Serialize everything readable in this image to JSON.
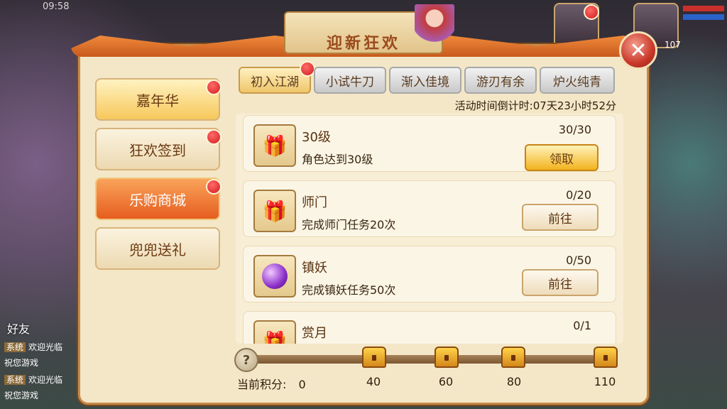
{
  "status": {
    "time": "09:58"
  },
  "window": {
    "title": "迎新狂欢",
    "close_label": "✕"
  },
  "sidebar": {
    "items": [
      {
        "label": "嘉年华",
        "has_dot": true
      },
      {
        "label": "狂欢签到",
        "has_dot": true
      },
      {
        "label": "乐购商城",
        "has_dot": true,
        "active": true
      },
      {
        "label": "兜兜送礼",
        "has_dot": false
      }
    ]
  },
  "tabs": [
    {
      "label": "初入江湖",
      "active": true,
      "has_dot": true
    },
    {
      "label": "小试牛刀"
    },
    {
      "label": "渐入佳境"
    },
    {
      "label": "游刃有余"
    },
    {
      "label": "炉火纯青"
    }
  ],
  "countdown": "活动时间倒计时:07天23小时52分",
  "tasks": [
    {
      "name": "30级",
      "desc": "角色达到30级",
      "progress": "30/30",
      "button": "领取",
      "icon": "gift-bag-icon"
    },
    {
      "name": "师门",
      "desc": "完成师门任务20次",
      "progress": "0/20",
      "button": "前往",
      "icon": "gift-bag-icon"
    },
    {
      "name": "镇妖",
      "desc": "完成镇妖任务50次",
      "progress": "0/50",
      "button": "前往",
      "icon": "exp-orb-icon"
    },
    {
      "name": "赏月",
      "desc": "",
      "progress": "0/1",
      "button": "",
      "icon": "gift-bag-icon"
    }
  ],
  "score": {
    "label": "当前积分:",
    "current": "0",
    "help": "?",
    "milestones": [
      "40",
      "60",
      "80",
      "110"
    ]
  },
  "hud": {
    "level": "107"
  },
  "chat": {
    "friend_label": "好友",
    "lines": [
      {
        "tag": "系统",
        "text": "欢迎光临"
      },
      {
        "tag": "",
        "text": "祝您游戏"
      },
      {
        "tag": "系统",
        "text": "欢迎光临"
      },
      {
        "tag": "",
        "text": "祝您游戏"
      }
    ]
  },
  "colors": {
    "accent": "#e65d1f",
    "dot": "#d11b1b",
    "panel": "#f3e7c7"
  }
}
